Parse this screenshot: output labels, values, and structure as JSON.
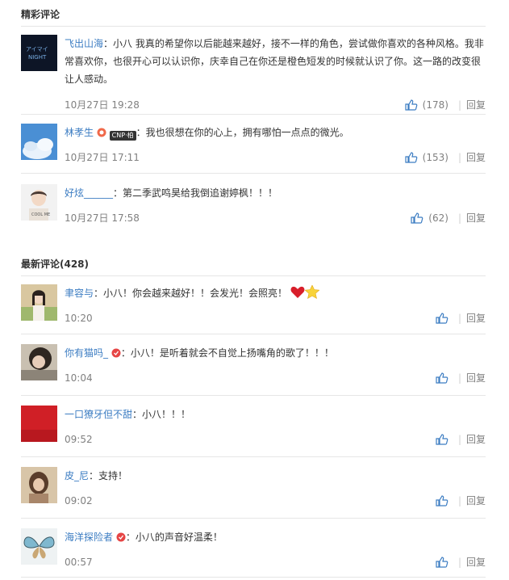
{
  "featured": {
    "title": "精彩评论",
    "comments": [
      {
        "user": "飞出山海",
        "colon": "：",
        "text": "小八 我真的希望你以后能越来越好，接不一样的角色，尝试做你喜欢的各种风格。我非常喜欢你，也很开心可以认识你，庆幸自己在你还是橙色短发的时候就认识了你。这一路的改变很让人感动。",
        "time": "10月27日 19:28",
        "likes": "(178)",
        "reply": "回复"
      },
      {
        "user": "林孝生",
        "badge_text": "CNP·柏",
        "colon": "：",
        "text": "我也很想在你的心上，拥有哪怕一点点的微光。",
        "time": "10月27日 17:11",
        "likes": "(153)",
        "reply": "回复"
      },
      {
        "user": "好炫______",
        "colon": "：",
        "text": "第二季武鸣昊给我倒追谢婷枫！！！",
        "time": "10月27日 17:58",
        "likes": "(62)",
        "reply": "回复"
      }
    ]
  },
  "latest": {
    "title": "最新评论(428)",
    "comments": [
      {
        "user": "聿容与",
        "colon": "：",
        "text": "小八！你会越来越好！！会发光！会照亮！",
        "time": "10:20",
        "reply": "回复",
        "emojis": [
          "heart-emoji",
          "star-emoji"
        ]
      },
      {
        "user": "你有猫吗_",
        "colon": "：",
        "text": "小八！是听着就会不自觉上扬嘴角的歌了！！！",
        "time": "10:04",
        "reply": "回复"
      },
      {
        "user": "一口獠牙但不甜",
        "colon": "：",
        "text": "小八！！！",
        "time": "09:52",
        "reply": "回复"
      },
      {
        "user": "皮_尼",
        "colon": "：",
        "text": "支持！",
        "time": "09:02",
        "reply": "回复"
      },
      {
        "user": "海洋探险者",
        "colon": "：",
        "text": "小八的声音好温柔！",
        "time": "00:57",
        "reply": "回复"
      }
    ]
  }
}
